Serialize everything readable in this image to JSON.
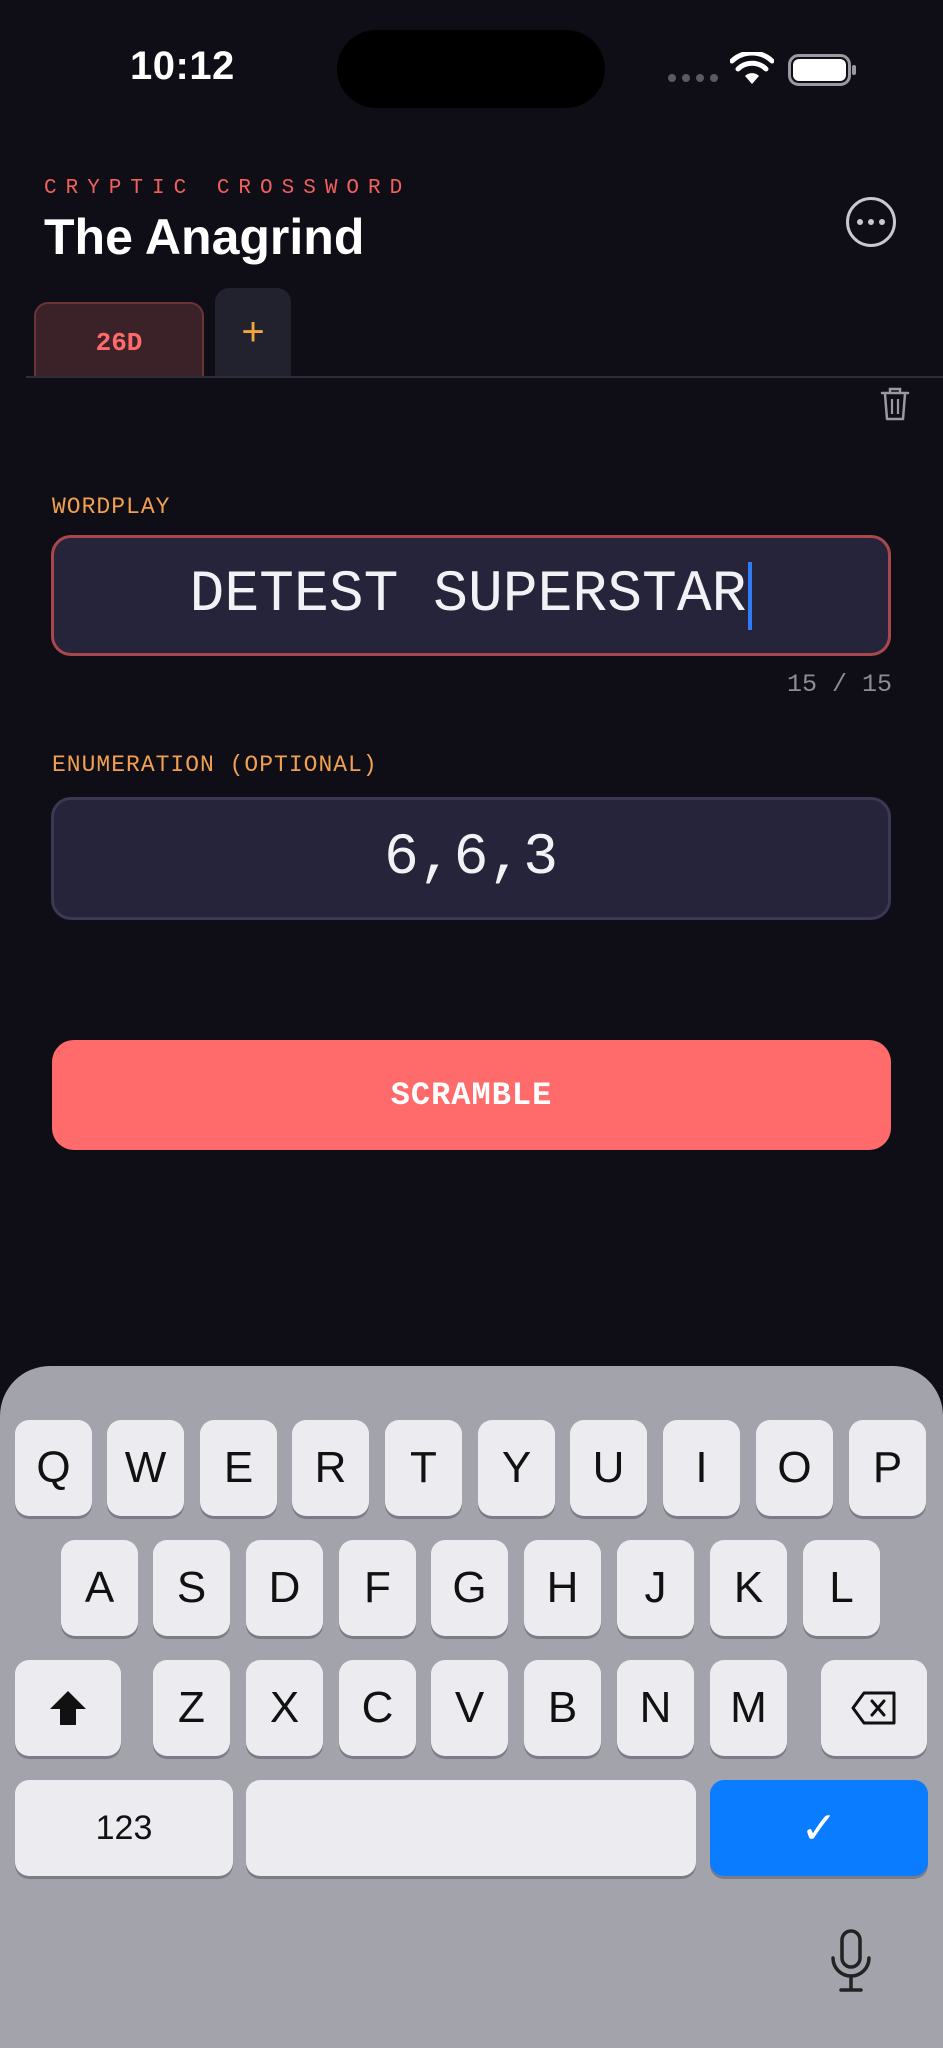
{
  "status_bar": {
    "time": "10:12"
  },
  "header": {
    "eyebrow": "CRYPTIC CROSSWORD",
    "title": "The Anagrind"
  },
  "tabs": {
    "active_label": "26D",
    "add_label": "+"
  },
  "wordplay": {
    "label": "WORDPLAY",
    "value": "DETEST SUPERSTAR",
    "counter": "15 / 15"
  },
  "enumeration": {
    "label": "ENUMERATION (OPTIONAL)",
    "value": "6,6,3"
  },
  "actions": {
    "scramble_label": "SCRAMBLE"
  },
  "keyboard": {
    "row1": [
      "Q",
      "W",
      "E",
      "R",
      "T",
      "Y",
      "U",
      "I",
      "O",
      "P"
    ],
    "row2": [
      "A",
      "S",
      "D",
      "F",
      "G",
      "H",
      "J",
      "K",
      "L"
    ],
    "row3": [
      "Z",
      "X",
      "C",
      "V",
      "B",
      "N",
      "M"
    ],
    "numbers_label": "123",
    "return_label": "✓"
  },
  "colors": {
    "accent": "#ff6b6b",
    "label": "#f0a050",
    "keyboard_go": "#0a7cff"
  },
  "icons": [
    "wifi-icon",
    "battery-icon",
    "more-icon",
    "trash-icon",
    "shift-icon",
    "backspace-icon",
    "microphone-icon"
  ]
}
